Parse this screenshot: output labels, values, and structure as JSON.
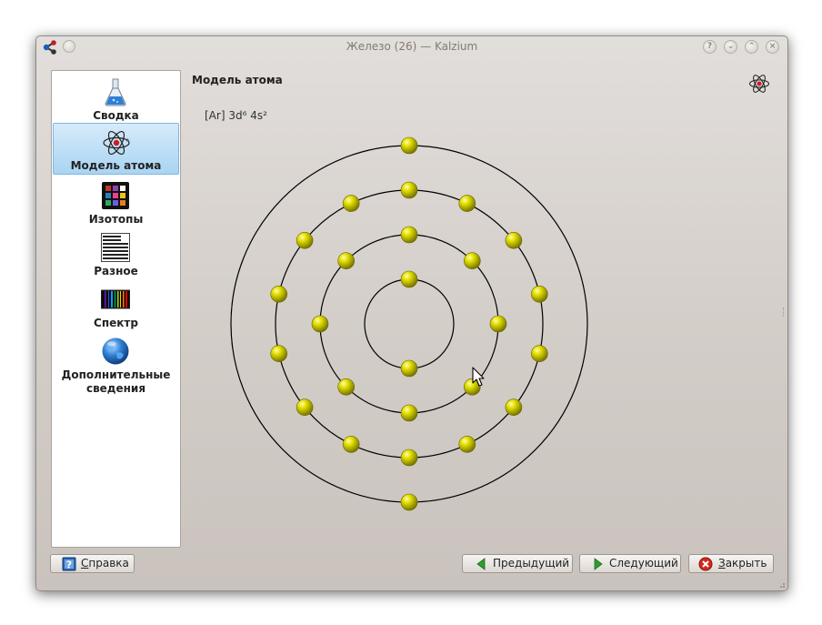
{
  "window": {
    "title": "Железо (26) — Kalzium"
  },
  "sidebar": {
    "items": [
      {
        "label": "Сводка",
        "icon": "flask-icon"
      },
      {
        "label": "Модель атома",
        "icon": "atom-icon",
        "selected": true
      },
      {
        "label": "Изотопы",
        "icon": "isotopes-icon"
      },
      {
        "label": "Разное",
        "icon": "misc-icon"
      },
      {
        "label": "Спектр",
        "icon": "spectrum-icon"
      },
      {
        "label": "Дополнительные сведения",
        "icon": "globe-icon"
      }
    ]
  },
  "main": {
    "heading": "Модель атома",
    "configuration": "[Ar] 3d⁶ 4s²",
    "shells": [
      {
        "electrons": 2
      },
      {
        "electrons": 8
      },
      {
        "electrons": 14
      },
      {
        "electrons": 2
      }
    ],
    "electron_color": "#d9d900",
    "shell_color": "#000000"
  },
  "buttons": {
    "help_label": "Справка",
    "help_mnemonic": "С",
    "help_rest": "правка",
    "prev_label": "Предыдущий",
    "next_label": "Следующий",
    "close_label": "Закрыть",
    "close_mnemonic": "З",
    "close_rest": "акрыть"
  },
  "colors": {
    "selection": "#a9d4f2",
    "nav_arrow": "#2e9e2e",
    "close_icon": "#d42a1e"
  }
}
